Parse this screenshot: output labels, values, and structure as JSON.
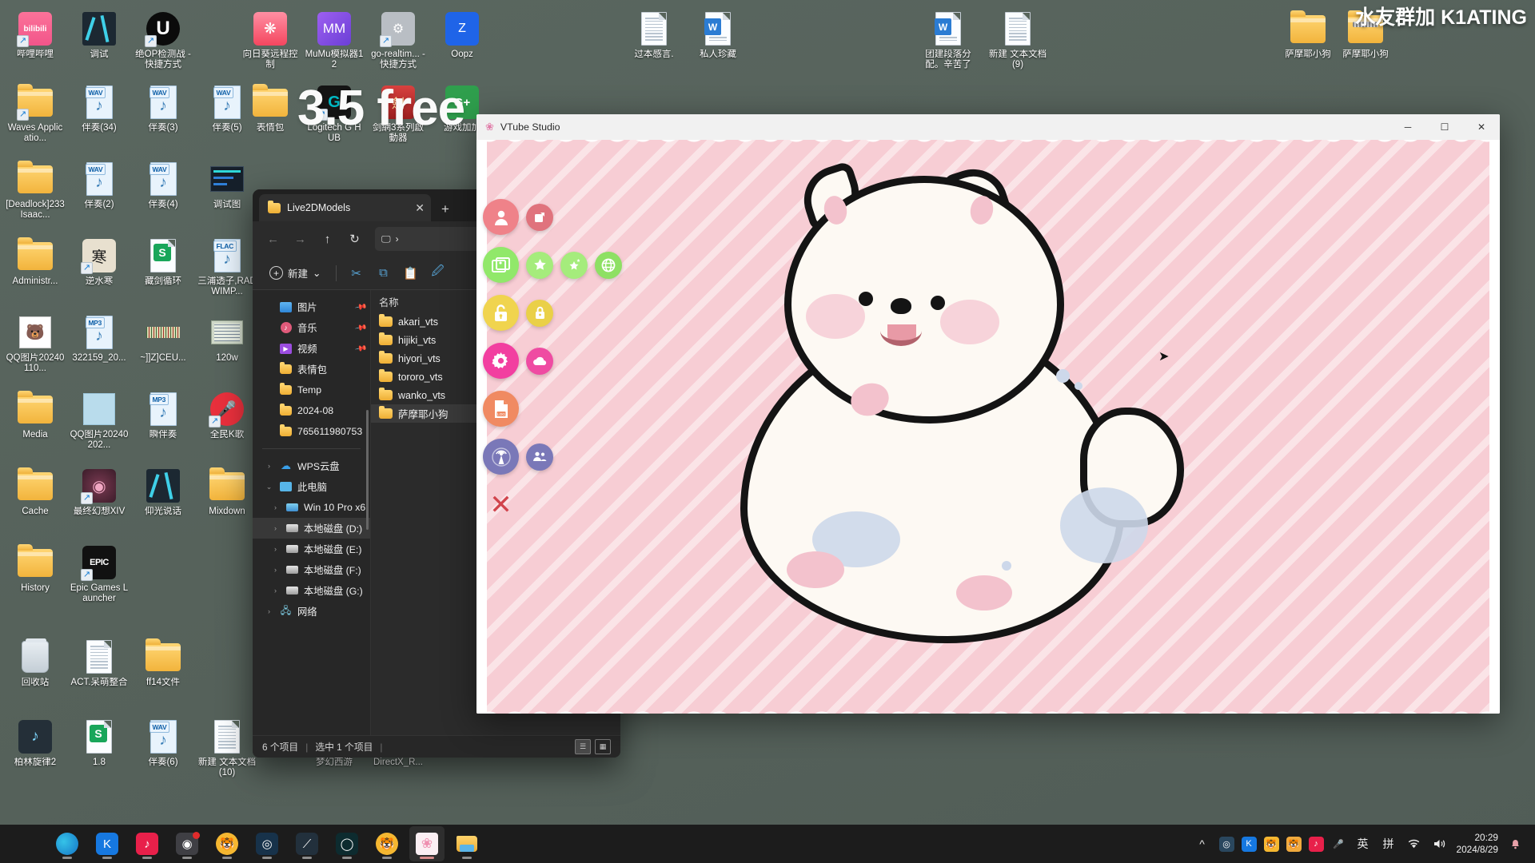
{
  "desktop": {
    "watermark": "水友群加 K1ATING",
    "big_text": "3.5 free",
    "icons": [
      {
        "label": "哔哩哔哩",
        "type": "app",
        "color": "#fb7299",
        "glyph": "bilibili",
        "shortcut": true
      },
      {
        "label": "调试",
        "type": "app",
        "color": "#22303c",
        "glyph": "blade",
        "shortcut": false
      },
      {
        "label": "绝OP检测战 - 快捷方式",
        "type": "app",
        "color": "#0d0d0d",
        "glyph": "U",
        "shortcut": true
      },
      {
        "label": "向日葵远程控制",
        "type": "app",
        "color": "#f94e6a",
        "glyph": "sun",
        "shortcut": false
      },
      {
        "label": "MuMu模拟器12",
        "type": "app",
        "color": "#8b52e0",
        "glyph": "mumu",
        "shortcut": false
      },
      {
        "label": "go-realtim... - 快捷方式",
        "type": "app",
        "color": "#b9bec4",
        "glyph": "gear",
        "shortcut": true
      },
      {
        "label": "Oopz",
        "type": "app",
        "color": "#1f64e8",
        "glyph": "Z",
        "shortcut": false
      },
      {
        "label": "过本感言.",
        "type": "doc",
        "glyph": "text",
        "shortcut": false
      },
      {
        "label": "私人珍藏",
        "type": "word",
        "glyph": "W",
        "shortcut": false
      },
      {
        "label": "团建段落分配。辛苦了",
        "type": "word",
        "glyph": "W",
        "shortcut": false
      },
      {
        "label": "新建 文本文档 (9)",
        "type": "doc",
        "glyph": "text",
        "shortcut": false
      },
      {
        "label": "萨摩耶小狗",
        "type": "folder",
        "glyph": "folder-open",
        "shortcut": false
      },
      {
        "label": "萨摩耶小狗",
        "type": "folder-zip",
        "glyph": "folder-zip",
        "shortcut": false
      },
      {
        "label": "Waves Applicatio...",
        "type": "folder",
        "glyph": "folder",
        "shortcut": true
      },
      {
        "label": "伴奏(34)",
        "type": "wav",
        "glyph": "WAV",
        "shortcut": false
      },
      {
        "label": "伴奏(3)",
        "type": "wav",
        "glyph": "WAV",
        "shortcut": false
      },
      {
        "label": "伴奏(5)",
        "type": "wav",
        "glyph": "WAV",
        "shortcut": false
      },
      {
        "label": "表情包",
        "type": "folder",
        "glyph": "folder",
        "shortcut": false
      },
      {
        "label": "Logitech G HUB",
        "type": "app",
        "color": "#161616",
        "glyph": "G",
        "shortcut": true
      },
      {
        "label": "剑網3系列啟動器",
        "type": "app",
        "color": "#c2262b",
        "glyph": "sword",
        "shortcut": false
      },
      {
        "label": "游戏加加",
        "type": "app",
        "color": "#2f9f4d",
        "glyph": "G+",
        "shortcut": false
      },
      {
        "label": "[Deadlock]233Isaac...",
        "type": "folder",
        "glyph": "folder",
        "shortcut": false
      },
      {
        "label": "伴奏(2)",
        "type": "wav",
        "glyph": "WAV",
        "shortcut": false
      },
      {
        "label": "伴奏(4)",
        "type": "wav",
        "glyph": "WAV",
        "shortcut": false
      },
      {
        "label": "调试图",
        "type": "img",
        "glyph": "waveform",
        "shortcut": false
      },
      {
        "label": "Administr...",
        "type": "folder",
        "glyph": "folder",
        "shortcut": false
      },
      {
        "label": "逆水寒",
        "type": "app",
        "color": "#e8e2d5",
        "glyph": "hanzi",
        "shortcut": true
      },
      {
        "label": "藏剑循环",
        "type": "sheet",
        "glyph": "S",
        "shortcut": false
      },
      {
        "label": "三浦透子,RADWIMP...",
        "type": "flac",
        "glyph": "FLAC",
        "shortcut": false
      },
      {
        "label": "QQ图片20240110...",
        "type": "img",
        "glyph": "bear",
        "shortcut": false
      },
      {
        "label": "322159_20...",
        "type": "mp3",
        "glyph": "MP3",
        "shortcut": false
      },
      {
        "label": "~]]Z]CEU...",
        "type": "img",
        "glyph": "barcode",
        "shortcut": false
      },
      {
        "label": "120w",
        "type": "img",
        "glyph": "screenshot",
        "shortcut": false
      },
      {
        "label": "Media",
        "type": "folder",
        "glyph": "folder",
        "shortcut": false
      },
      {
        "label": "QQ图片20240202...",
        "type": "img",
        "glyph": "blue",
        "shortcut": false
      },
      {
        "label": "瞬伴奏",
        "type": "mp3",
        "glyph": "MP3",
        "shortcut": false
      },
      {
        "label": "全民K歌",
        "type": "app",
        "color": "#e8303c",
        "glyph": "mic",
        "shortcut": true
      },
      {
        "label": "Cache",
        "type": "folder",
        "glyph": "folder",
        "shortcut": false
      },
      {
        "label": "最终幻想XIV",
        "type": "app",
        "color": "#6b3a4e",
        "glyph": "ff",
        "shortcut": true
      },
      {
        "label": "仰光说话",
        "type": "app",
        "color": "#22303c",
        "glyph": "blade",
        "shortcut": false
      },
      {
        "label": "Mixdown",
        "type": "folder",
        "glyph": "folder",
        "shortcut": false
      },
      {
        "label": "History",
        "type": "folder",
        "glyph": "folder-open",
        "shortcut": false
      },
      {
        "label": "Epic Games Launcher",
        "type": "app",
        "color": "#111111",
        "glyph": "EPIC",
        "shortcut": true
      },
      {
        "label": "回收站",
        "type": "recycle",
        "glyph": "trash",
        "shortcut": false
      },
      {
        "label": "ACT.呆萌整合",
        "type": "doc",
        "glyph": "text",
        "shortcut": false
      },
      {
        "label": "ff14文件",
        "type": "folder",
        "glyph": "folder",
        "shortcut": false
      },
      {
        "label": "柏林旋律2",
        "type": "app",
        "color": "#2f3a44",
        "glyph": "note",
        "shortcut": false
      },
      {
        "label": "1.8",
        "type": "sheet",
        "glyph": "S",
        "shortcut": false
      },
      {
        "label": "伴奏(6)",
        "type": "wav",
        "glyph": "WAV",
        "shortcut": false
      },
      {
        "label": "新建 文本文档 (10)",
        "type": "doc",
        "glyph": "text",
        "shortcut": false
      },
      {
        "label": "梦幻西游",
        "type": "app",
        "color": "#d7c9a8",
        "glyph": "mh",
        "shortcut": true
      },
      {
        "label": "DirectX_R...",
        "type": "app",
        "color": "#2f7a3f",
        "glyph": "dx",
        "shortcut": false
      }
    ]
  },
  "explorer": {
    "tab_title": "Live2DModels",
    "tab_close_label": "✕",
    "new_tab_label": "+",
    "nav": {
      "back": "←",
      "forward": "→",
      "up": "↑",
      "refresh": "↻",
      "address_icon": "🖵",
      "address_chevron": "›"
    },
    "toolbar": {
      "new_label": "新建",
      "new_chevron": "⌄",
      "cut_icon": "✂",
      "copy_icon": "⧉",
      "paste_icon": "📋",
      "rename_icon": "🖉"
    },
    "sidebar": [
      {
        "label": "图片",
        "icon": "picture",
        "pinned": true,
        "chevron": "",
        "indent": 0
      },
      {
        "label": "音乐",
        "icon": "music",
        "pinned": true,
        "chevron": "",
        "indent": 0
      },
      {
        "label": "视频",
        "icon": "video",
        "pinned": true,
        "chevron": "",
        "indent": 0
      },
      {
        "label": "表情包",
        "icon": "folder",
        "pinned": false,
        "chevron": "",
        "indent": 0
      },
      {
        "label": "Temp",
        "icon": "folder",
        "pinned": false,
        "chevron": "",
        "indent": 0
      },
      {
        "label": "2024-08",
        "icon": "folder",
        "pinned": false,
        "chevron": "",
        "indent": 0
      },
      {
        "label": "765611980753",
        "icon": "folder",
        "pinned": false,
        "chevron": "",
        "indent": 0
      }
    ],
    "sidebar_tree": [
      {
        "label": "WPS云盘",
        "icon": "cloud",
        "chevron": "›",
        "indent": 0,
        "selected": false
      },
      {
        "label": "此电脑",
        "icon": "pc",
        "chevron": "⌄",
        "indent": 0,
        "selected": false
      },
      {
        "label": "Win 10 Pro x6",
        "icon": "disk-win",
        "chevron": "›",
        "indent": 1,
        "selected": false
      },
      {
        "label": "本地磁盘 (D:)",
        "icon": "disk",
        "chevron": "›",
        "indent": 1,
        "selected": true
      },
      {
        "label": "本地磁盘 (E:)",
        "icon": "disk",
        "chevron": "›",
        "indent": 1,
        "selected": false
      },
      {
        "label": "本地磁盘 (F:)",
        "icon": "disk",
        "chevron": "›",
        "indent": 1,
        "selected": false
      },
      {
        "label": "本地磁盘 (G:)",
        "icon": "disk",
        "chevron": "›",
        "indent": 1,
        "selected": false
      },
      {
        "label": "网络",
        "icon": "network",
        "chevron": "›",
        "indent": 0,
        "selected": false
      }
    ],
    "list_header": "名称",
    "files": [
      {
        "name": "akari_vts",
        "selected": false
      },
      {
        "name": "hijiki_vts",
        "selected": false
      },
      {
        "name": "hiyori_vts",
        "selected": false
      },
      {
        "name": "tororo_vts",
        "selected": false
      },
      {
        "name": "wanko_vts",
        "selected": false
      },
      {
        "name": "萨摩耶小狗",
        "selected": true
      }
    ],
    "status": {
      "count": "6 个项目",
      "sep1": "|",
      "selected": "选中 1 个项目",
      "sep2": "|",
      "view_list_icon": "☰",
      "view_grid_icon": "▦"
    }
  },
  "vtube": {
    "title": "VTube Studio",
    "logo_icon": "petal-icon",
    "minimize": "─",
    "maximize": "☐",
    "close": "✕",
    "buttons": [
      {
        "name": "model-selection",
        "icon": "person",
        "color": "#ef8289",
        "size": "big"
      },
      {
        "name": "export-model",
        "icon": "share",
        "color": "#e0737d",
        "size": "sm"
      },
      {
        "name": "backgrounds",
        "icon": "images",
        "color": "#91e86a",
        "size": "big"
      },
      {
        "name": "items-favorites",
        "icon": "star",
        "color": "#a5ec7c",
        "size": "sm"
      },
      {
        "name": "effects",
        "icon": "sparkles",
        "color": "#a5ec7c",
        "size": "sm"
      },
      {
        "name": "workshop",
        "icon": "globe",
        "color": "#8ee064",
        "size": "sm"
      },
      {
        "name": "unlock-model",
        "icon": "unlock",
        "color": "#f0d44e",
        "size": "big"
      },
      {
        "name": "lock-model",
        "icon": "lock",
        "color": "#ead048",
        "size": "sm"
      },
      {
        "name": "settings",
        "icon": "gear",
        "color": "#f23fa0",
        "size": "big"
      },
      {
        "name": "cloud-sync",
        "icon": "cloud",
        "color": "#ef4ba2",
        "size": "sm"
      },
      {
        "name": "log-file",
        "icon": "log-doc",
        "color": "#f08a62",
        "size": "big"
      },
      {
        "name": "streaming",
        "icon": "broadcast",
        "color": "#7a78b8",
        "size": "big"
      },
      {
        "name": "viewers",
        "icon": "people",
        "color": "#7a78b8",
        "size": "sm"
      },
      {
        "name": "close-menu",
        "icon": "x-mark",
        "color": "#d1444c",
        "size": "x"
      }
    ],
    "model_name": "萨摩耶小狗"
  },
  "taskbar": {
    "apps": [
      {
        "name": "start",
        "label": "Windows",
        "color": "#3aa0e8",
        "glyph": "▦",
        "active": false,
        "running": false,
        "badge": false
      },
      {
        "name": "edge",
        "label": "Microsoft Edge",
        "color": "#1a9bd7",
        "glyph": "e",
        "active": false,
        "running": true,
        "badge": false
      },
      {
        "name": "kugou",
        "label": "酷狗",
        "color": "#1678e0",
        "glyph": "K",
        "active": false,
        "running": true,
        "badge": false
      },
      {
        "name": "netease-music",
        "label": "网易云音乐",
        "color": "#e8204a",
        "glyph": "♪",
        "active": false,
        "running": true,
        "badge": false
      },
      {
        "name": "obs",
        "label": "OBS Studio",
        "color": "#3f3f44",
        "glyph": "◉",
        "active": false,
        "running": true,
        "badge": true
      },
      {
        "name": "tiger-app",
        "label": "虎牙",
        "color": "#f5b731",
        "glyph": "🐯",
        "active": false,
        "running": true,
        "badge": false
      },
      {
        "name": "steam",
        "label": "Steam",
        "color": "#17324a",
        "glyph": "◎",
        "active": false,
        "running": true,
        "badge": false
      },
      {
        "name": "blade-app",
        "label": "调试",
        "color": "#22303c",
        "glyph": "⟋",
        "active": false,
        "running": true,
        "badge": false
      },
      {
        "name": "circle-app",
        "label": "应用",
        "color": "#0d2b2f",
        "glyph": "◯",
        "active": false,
        "running": true,
        "badge": false
      },
      {
        "name": "tiger-app-2",
        "label": "虎牙助手",
        "color": "#f5b731",
        "glyph": "🐯",
        "active": false,
        "running": true,
        "badge": false
      },
      {
        "name": "vtube-studio",
        "label": "VTube Studio",
        "color": "#f5d0dd",
        "glyph": "❀",
        "active": true,
        "running": true,
        "badge": false
      },
      {
        "name": "file-explorer",
        "label": "文件资源管理器",
        "color": "#f0b53a",
        "glyph": "🗀",
        "active": false,
        "running": true,
        "badge": false
      }
    ],
    "tray": {
      "overflow": "^",
      "icons": [
        {
          "name": "steam-tray",
          "glyph": "◎",
          "color": "#2a475e"
        },
        {
          "name": "kugou-tray",
          "glyph": "K",
          "color": "#1678e0"
        },
        {
          "name": "tiger-tray-1",
          "glyph": "🐯",
          "color": "#f5b731"
        },
        {
          "name": "tiger-tray-2",
          "glyph": "🐯",
          "color": "#f0a93d"
        },
        {
          "name": "netease-tray",
          "glyph": "♪",
          "color": "#e8204a"
        },
        {
          "name": "microphone-tray",
          "glyph": "🎤",
          "color": "transparent"
        }
      ],
      "ime_lang": "英",
      "ime_mode": "拼",
      "wifi": "wifi-icon",
      "volume": "volume-icon",
      "time": "20:29",
      "date": "2024/8/29",
      "notification": "notification-bell-icon"
    }
  }
}
